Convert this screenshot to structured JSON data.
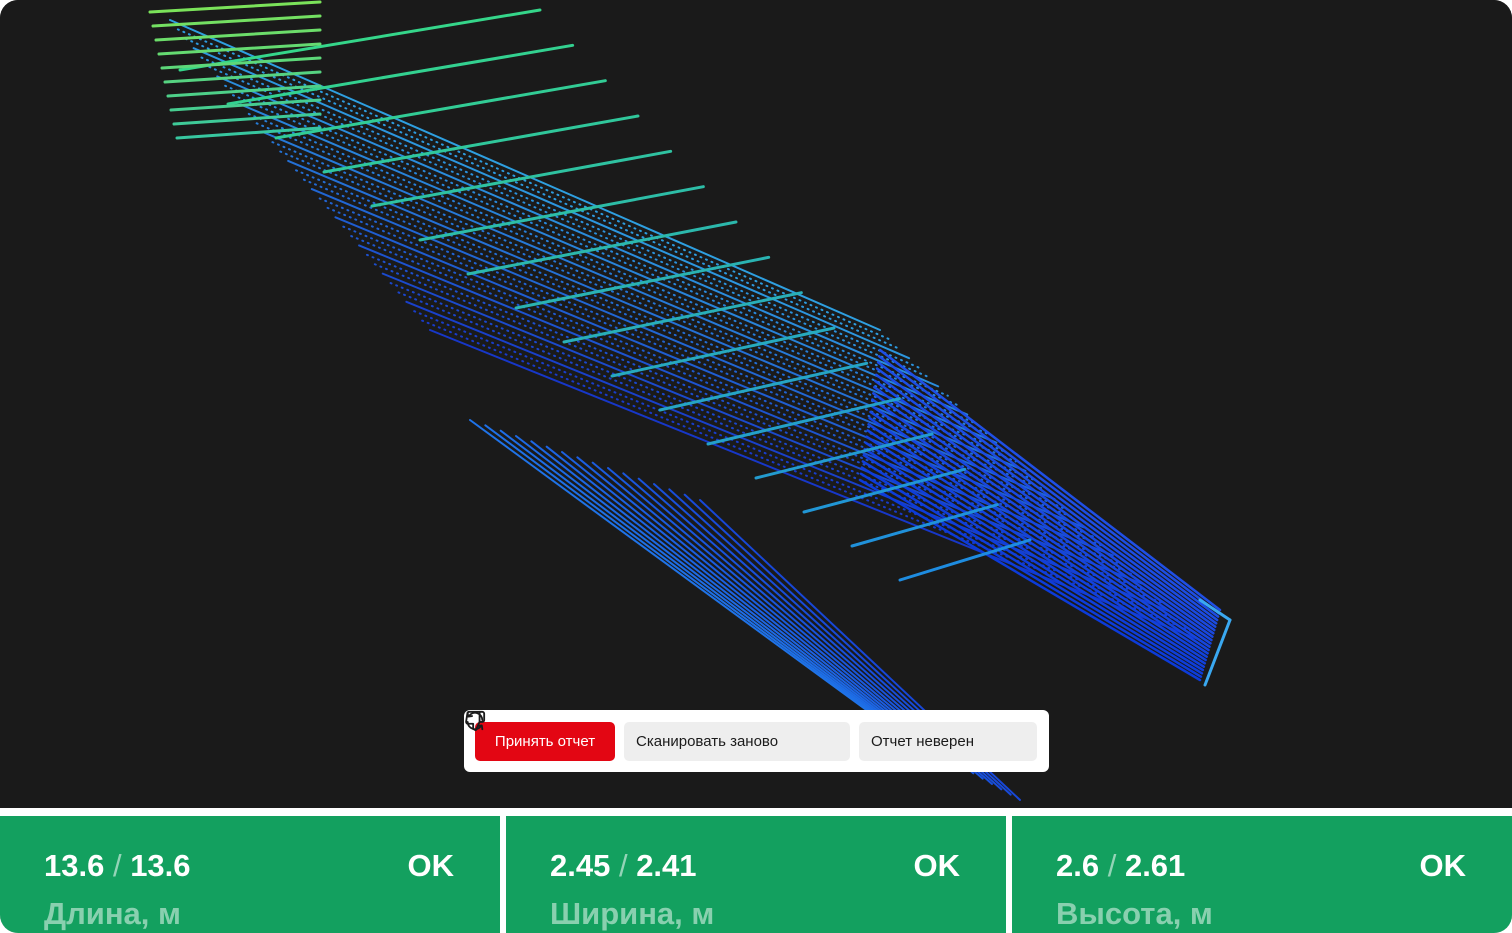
{
  "toolbar": {
    "accept_label": "Принять отчет",
    "rescan_label": "Сканировать заново",
    "report_wrong_label": "Отчет неверен",
    "rescan_icon": "refresh-icon",
    "report_wrong_icon": "thumbs-down-icon"
  },
  "colors": {
    "accent": "#e30613",
    "status_ok": "#13a05f",
    "viewport_bg": "#1a1a1a"
  },
  "stats": [
    {
      "measured": "13.6",
      "expected": "13.6",
      "status": "OK",
      "label": "Длина, м"
    },
    {
      "measured": "2.45",
      "expected": "2.41",
      "status": "OK",
      "label": "Ширина, м"
    },
    {
      "measured": "2.6",
      "expected": "2.61",
      "status": "OK",
      "label": "Высота, м"
    }
  ]
}
